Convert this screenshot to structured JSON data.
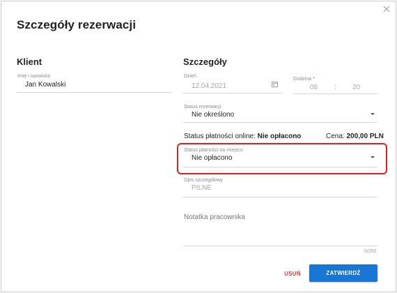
{
  "dialog": {
    "title": "Szczegóły rezerwacji",
    "close_icon": "close-icon"
  },
  "client": {
    "heading": "Klient",
    "name_label": "Imię i nazwisko",
    "name_value": "Jan Kowalski"
  },
  "details": {
    "heading": "Szczegóły",
    "date_label": "Dzień",
    "date_value": "12.04.2021",
    "time_label": "Godzina",
    "time_required_mark": "*",
    "time_hour": "08",
    "time_separator": ":",
    "time_minute": "20",
    "reservation_status_label": "Status rezerwacji",
    "reservation_status_value": "Nie określono",
    "online_payment_label": "Status płatności online:",
    "online_payment_value": "Nie opłacono",
    "price_label": "Cena:",
    "price_value": "200,00 PLN",
    "onsite_payment_label": "Status płatności na miejscu",
    "onsite_payment_value": "Nie opłacono",
    "description_label": "Opis szczegółowy",
    "description_value": "PILNE",
    "employee_note_placeholder": "Notatka pracownika",
    "employee_note_counter": "0/250"
  },
  "actions": {
    "delete_label": "USUŃ",
    "confirm_label": "ZATWIERDŹ"
  },
  "colors": {
    "accent": "#1976d2",
    "danger": "#e53935",
    "highlight": "#e11d1d"
  }
}
